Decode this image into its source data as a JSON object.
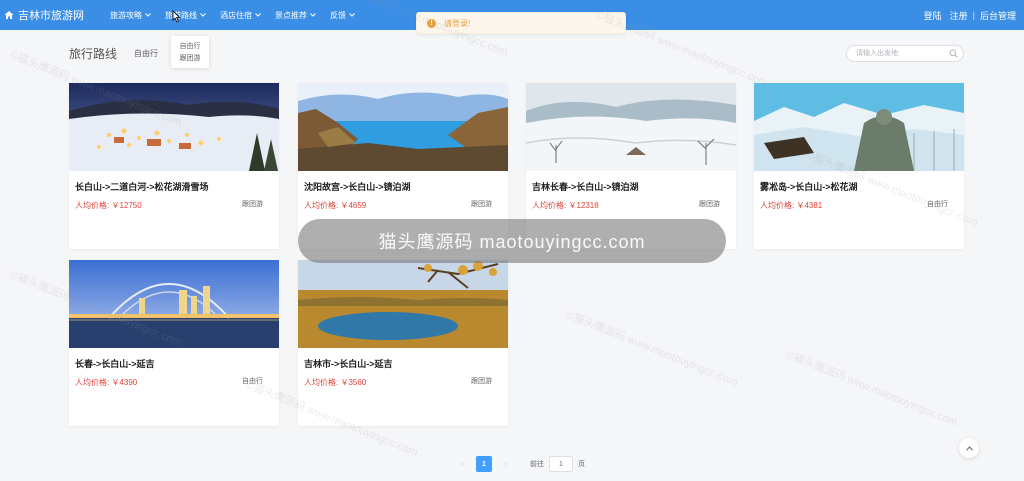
{
  "brand": {
    "name": "吉林市旅游网"
  },
  "nav": {
    "items": [
      {
        "label": "旅游攻略"
      },
      {
        "label": "旅游路线"
      },
      {
        "label": "酒店住宿"
      },
      {
        "label": "景点推荐"
      },
      {
        "label": "反馈"
      }
    ],
    "right": {
      "login": "登陆",
      "register": "注册",
      "separator": "|",
      "admin": "后台管理"
    }
  },
  "toast": {
    "message": "请登录!",
    "icon": "warning-icon"
  },
  "dropdown": {
    "items": [
      "自由行",
      "跟团游"
    ]
  },
  "page": {
    "title": "旅行路线",
    "filter": "自由行"
  },
  "search": {
    "placeholder": "请输入出发地",
    "value": ""
  },
  "price_prefix": "人均价格: ￥",
  "routes": [
    {
      "title": "长白山->二道白河->松花湖滑雪场",
      "price": "12750",
      "type": "跟团游"
    },
    {
      "title": "沈阳故宫->长白山->镜泊湖",
      "price": "4659",
      "type": "跟团游"
    },
    {
      "title": "吉林长春->长白山->镜泊湖",
      "price": "12318",
      "type": "跟团游"
    },
    {
      "title": "雾凇岛->长白山->松花湖",
      "price": "4381",
      "type": "自由行"
    },
    {
      "title": "长春->长白山->延吉",
      "price": "4390",
      "type": "自由行"
    },
    {
      "title": "吉林市->长白山->延吉",
      "price": "3560",
      "type": "跟团游"
    }
  ],
  "watermark": {
    "banner": "猫头鹰源码 maotouyingcc.com",
    "text": "©猫头鹰源码 www.maotouyingcc.com"
  },
  "pagination": {
    "prev": "‹",
    "current": "1",
    "next": "›",
    "goto_label": "前往",
    "goto_value": "1",
    "page_unit": "页"
  },
  "colors": {
    "navbar": "#3a8ee6",
    "price": "#e0443a",
    "accent": "#409eff",
    "warning": "#e6a23c"
  }
}
